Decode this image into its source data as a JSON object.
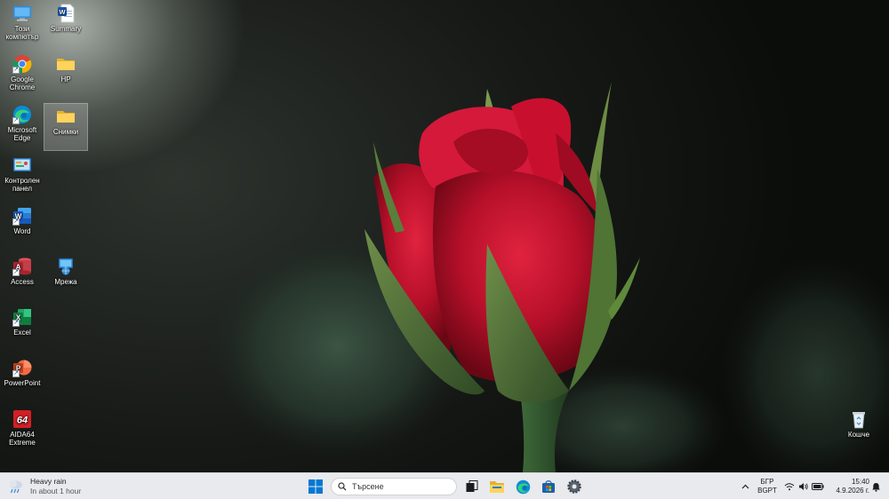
{
  "desktop": {
    "icons": [
      {
        "label": "Този компютър",
        "icon": "monitor-icon"
      },
      {
        "label": "Summary",
        "icon": "word-document-icon"
      },
      {
        "label": "Google Chrome",
        "icon": "chrome-icon"
      },
      {
        "label": "HP",
        "icon": "folder-icon"
      },
      {
        "label": "Microsoft Edge",
        "icon": "edge-icon"
      },
      {
        "label": "Снимки",
        "icon": "folder-icon"
      },
      {
        "label": "Контролен панел",
        "icon": "control-panel-icon"
      },
      {
        "label": "Word",
        "icon": "word-icon"
      },
      {
        "label": "Access",
        "icon": "access-icon"
      },
      {
        "label": "Мрежа",
        "icon": "network-icon"
      },
      {
        "label": "Excel",
        "icon": "excel-icon"
      },
      {
        "label": "PowerPoint",
        "icon": "powerpoint-icon"
      },
      {
        "label": "AIDA64 Extreme",
        "icon": "aida64-icon"
      },
      {
        "label": "Кошче",
        "icon": "recycle-bin-icon"
      }
    ],
    "selected_icon": "Снимки"
  },
  "taskbar": {
    "weather": {
      "title": "Heavy rain",
      "subtitle": "In about 1 hour",
      "icon": "rain-cloud-icon"
    },
    "search_placeholder": "Търсене",
    "pinned": [
      "start-icon",
      "task-view-icon",
      "file-explorer-icon",
      "edge-icon",
      "microsoft-store-icon",
      "settings-icon"
    ],
    "tray": {
      "language_line1": "БГР",
      "language_line2": "BGPT",
      "time": "15:40",
      "date": "4.9.2026 г."
    }
  },
  "colors": {
    "taskbar_bg": "#e8eaed",
    "rose_red": "#c8102e",
    "windows_blue": "#0078d4"
  }
}
